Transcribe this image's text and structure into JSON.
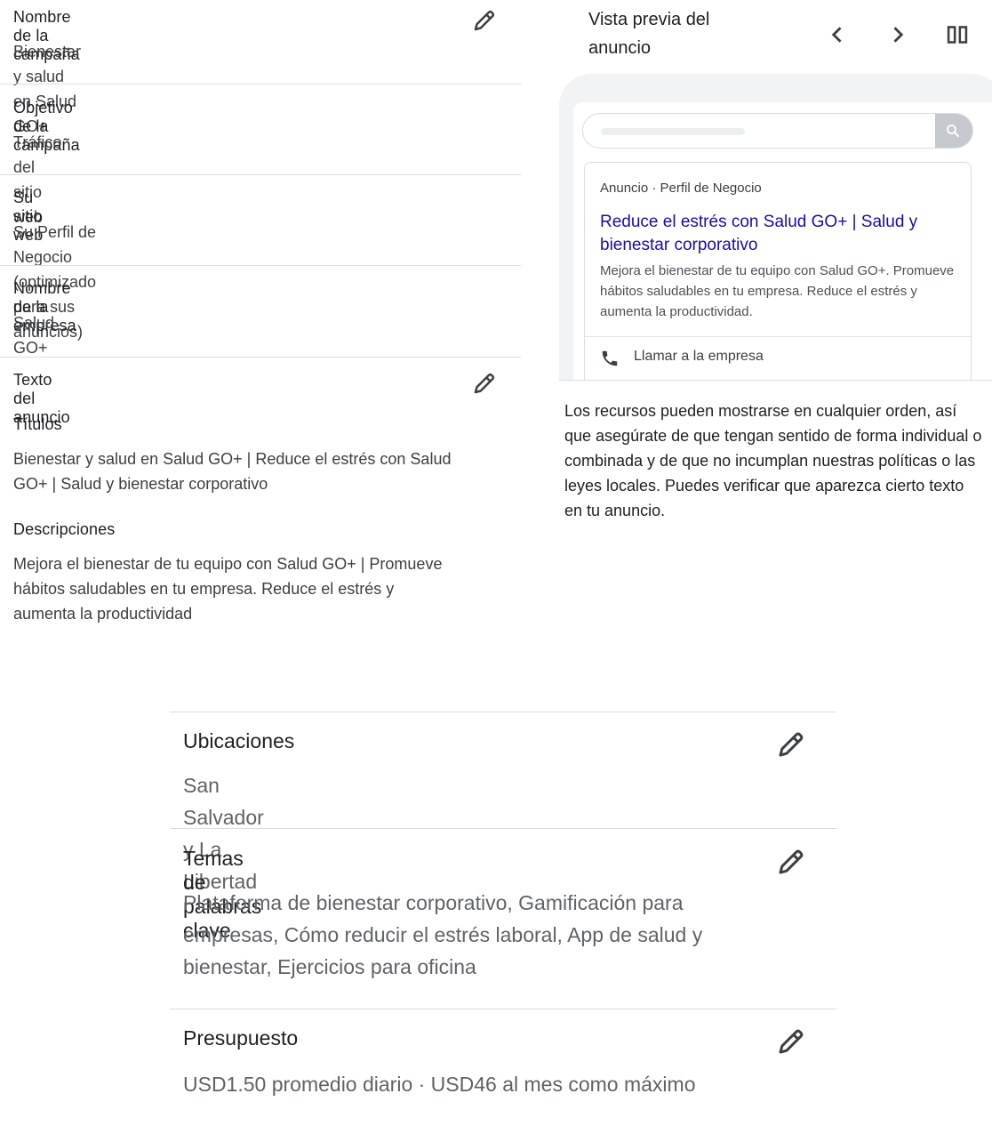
{
  "summary": {
    "campaign_name": {
      "label": "Nombre de la campaña",
      "value": "Bienestar y salud en Salud GO+"
    },
    "campaign_goal": {
      "label": "Objetivo de la campaña",
      "value": "Tráfico del sitio web"
    },
    "website": {
      "label": "Su sitio web",
      "value": "Su Perfil de Negocio (optimizado para sus anuncios)"
    },
    "business_name": {
      "label": "Nombre de la empresa",
      "value": "Salud GO+"
    },
    "ad_text": {
      "label": "Texto del anuncio",
      "titles_label": "Títulos",
      "titles_value": "Bienestar y salud en Salud GO+ | Reduce el estrés con Salud GO+ | Salud y bienestar corporativo",
      "descriptions_label": "Descripciones",
      "descriptions_value": "Mejora el bienestar de tu equipo con Salud GO+ | Promueve hábitos saludables en tu empresa. Reduce el estrés y aumenta la productividad"
    }
  },
  "preview": {
    "title": "Vista previa del anuncio",
    "ad": {
      "meta": "Anuncio · Perfil de Negocio",
      "headline": "Reduce el estrés con Salud GO+ | Salud y bienestar corporativo",
      "description": "Mejora el bienestar de tu equipo con Salud GO+. Promueve hábitos saludables en tu empresa. Reduce el estrés y aumenta la productividad.",
      "call_label": "Llamar a la empresa"
    },
    "notice": "Los recursos pueden mostrarse en cualquier orden, así que asegúrate de que tengan sentido de forma individual o combinada y de que no incumplan nuestras políticas o las leyes locales. Puedes verificar que aparezca cierto texto en tu anuncio."
  },
  "settings": {
    "locations": {
      "label": "Ubicaciones",
      "value": "San Salvador y La Libertad"
    },
    "keywords": {
      "label": "Temas de palabras clave",
      "value": "Plataforma de bienestar corporativo, Gamificación para empresas, Cómo reducir el estrés laboral, App de salud y bienestar, Ejercicios para oficina"
    },
    "budget": {
      "label": "Presupuesto",
      "value": "USD1.50 promedio diario · USD46 al mes como máximo"
    }
  },
  "icons": {
    "edit": "pencil-icon",
    "prev": "chevron-left-icon",
    "next": "chevron-right-icon",
    "layout": "columns-icon",
    "search": "search-icon",
    "phone": "phone-icon"
  },
  "colors": {
    "link": "#1a0dab",
    "divider": "#dadce0",
    "text": "#3c4043"
  }
}
